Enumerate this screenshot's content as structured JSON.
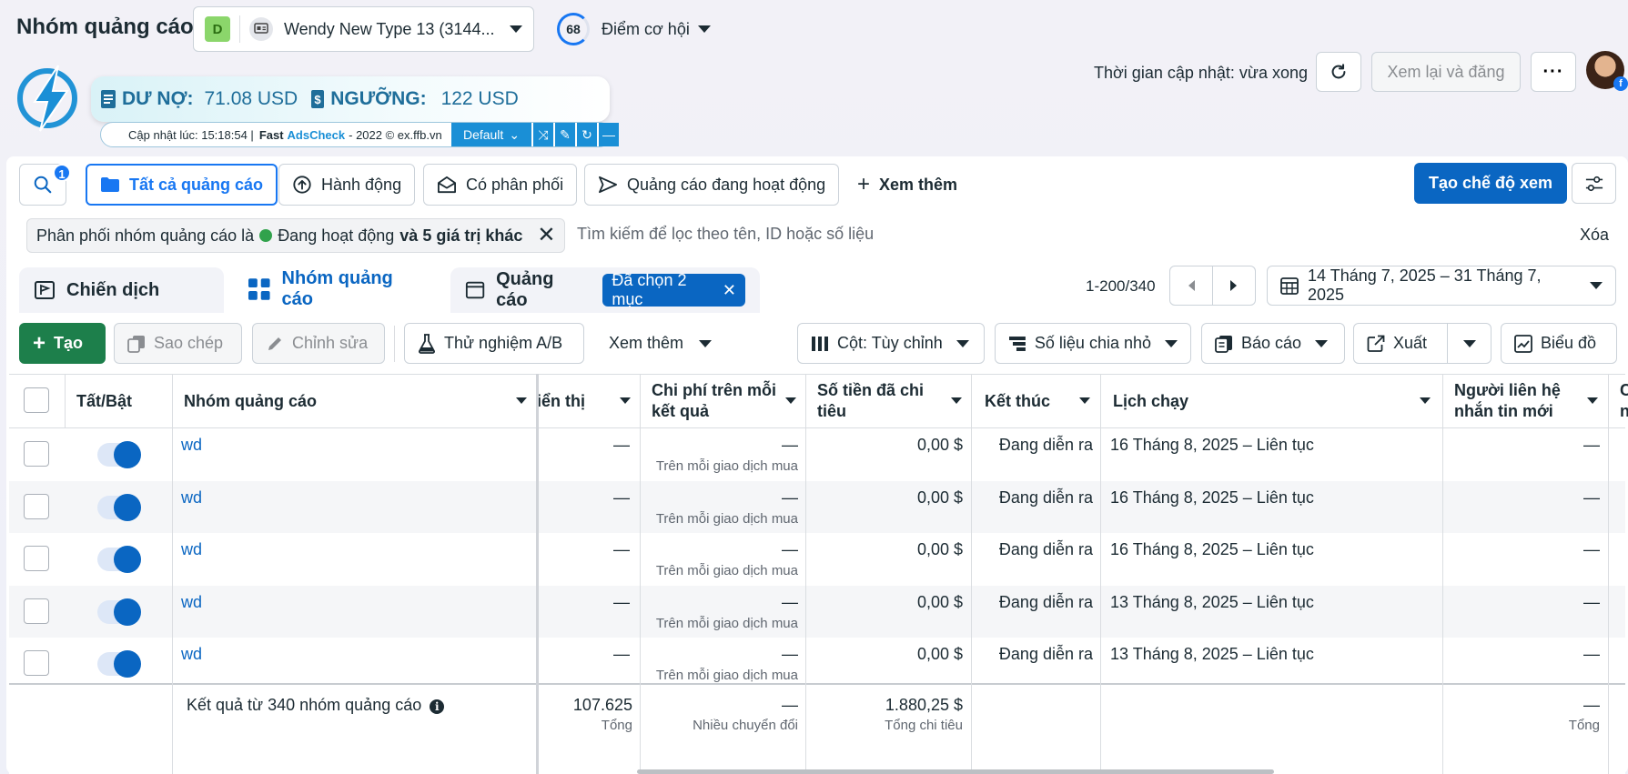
{
  "header": {
    "title": "Nhóm quảng cáo",
    "account_badge": "D",
    "account_name": "Wendy New Type 13 (3144...",
    "opportunity_score": "68",
    "opportunity_label": "Điểm cơ hội",
    "update_time": "Thời gian cập nhật: vừa xong",
    "review_publish": "Xem lại và đăng",
    "more": "···"
  },
  "extension": {
    "debt_label": "DƯ NỢ:",
    "debt_value": "71.08 USD",
    "threshold_label": "NGƯỠNG:",
    "threshold_value": "122 USD",
    "updated_at": "Cập nhật lúc: 15:18:54 |",
    "brand_fast": "Fast",
    "brand_adscheck": "AdsCheck",
    "copyright": "- 2022 © ex.ffb.vn",
    "preset": "Default"
  },
  "tabs": {
    "search_count": "1",
    "all_ads": "Tất cả quảng cáo",
    "actions": "Hành động",
    "has_delivery": "Có phân phối",
    "active_ads": "Quảng cáo đang hoạt động",
    "see_more": "Xem thêm",
    "create_view": "Tạo chế độ xem"
  },
  "filter": {
    "prefix": "Phân phối nhóm quảng cáo là",
    "status": "Đang hoạt động",
    "extra": "và 5 giá trị khác",
    "search_placeholder": "Tìm kiếm để lọc theo tên, ID hoặc số liệu",
    "clear": "Xóa"
  },
  "levels": {
    "campaign": "Chiến dịch",
    "adset": "Nhóm quảng cáo",
    "ad": "Quảng cáo",
    "selected": "Đã chọn 2 mục"
  },
  "pagination": "1-200/340",
  "date_range": "14 Tháng 7, 2025 – 31 Tháng 7, 2025",
  "toolbar": {
    "create": "Tạo",
    "copy": "Sao chép",
    "edit": "Chỉnh sửa",
    "ab_test": "Thử nghiệm A/B",
    "more": "Xem thêm",
    "columns": "Cột: Tùy chỉnh",
    "breakdown": "Số liệu chia nhỏ",
    "reports": "Báo cáo",
    "export": "Xuất",
    "chart": "Biểu đồ"
  },
  "table": {
    "headers": {
      "toggle": "Tất/Bật",
      "name": "Nhóm quảng cáo",
      "impressions": "iển thị",
      "cost_per_result_1": "Chi phí trên mỗi",
      "cost_per_result_2": "kết quả",
      "amount_spent_1": "Số tiền đã chi",
      "amount_spent_2": "tiêu",
      "ends": "Kết thúc",
      "schedule": "Lịch chạy",
      "contacts_1": "Người liên hệ",
      "contacts_2": "nhắn tin mới",
      "cut_1": "C",
      "cut_2": "n"
    },
    "rows": [
      {
        "name": "wd",
        "impressions": "—",
        "cpr": "—",
        "cpr_sub": "Trên mỗi giao dịch mua",
        "spent": "0,00 $",
        "ends": "Đang diễn ra",
        "schedule": "16 Tháng 8, 2025 – Liên tục",
        "contacts": "—"
      },
      {
        "name": "wd",
        "impressions": "—",
        "cpr": "—",
        "cpr_sub": "Trên mỗi giao dịch mua",
        "spent": "0,00 $",
        "ends": "Đang diễn ra",
        "schedule": "16 Tháng 8, 2025 – Liên tục",
        "contacts": "—"
      },
      {
        "name": "wd",
        "impressions": "—",
        "cpr": "—",
        "cpr_sub": "Trên mỗi giao dịch mua",
        "spent": "0,00 $",
        "ends": "Đang diễn ra",
        "schedule": "16 Tháng 8, 2025 – Liên tục",
        "contacts": "—"
      },
      {
        "name": "wd",
        "impressions": "—",
        "cpr": "—",
        "cpr_sub": "Trên mỗi giao dịch mua",
        "spent": "0,00 $",
        "ends": "Đang diễn ra",
        "schedule": "13 Tháng 8, 2025 – Liên tục",
        "contacts": "—"
      },
      {
        "name": "wd",
        "impressions": "—",
        "cpr": "—",
        "cpr_sub": "Trên mỗi giao dịch mua",
        "spent": "0,00 $",
        "ends": "Đang diễn ra",
        "schedule": "13 Tháng 8, 2025 – Liên tục",
        "contacts": "—"
      }
    ],
    "totals": {
      "label": "Kết quả từ 340 nhóm quảng cáo",
      "impressions": "107.625",
      "impressions_sub": "Tổng",
      "cpr": "—",
      "cpr_sub": "Nhiều chuyển đổi",
      "spent": "1.880,25 $",
      "spent_sub": "Tổng chi tiêu",
      "contacts": "—",
      "contacts_sub": "Tổng"
    }
  },
  "colors": {
    "accent": "#0a66c2",
    "create_green": "#1d7f4b",
    "status_green": "#31a24c"
  }
}
